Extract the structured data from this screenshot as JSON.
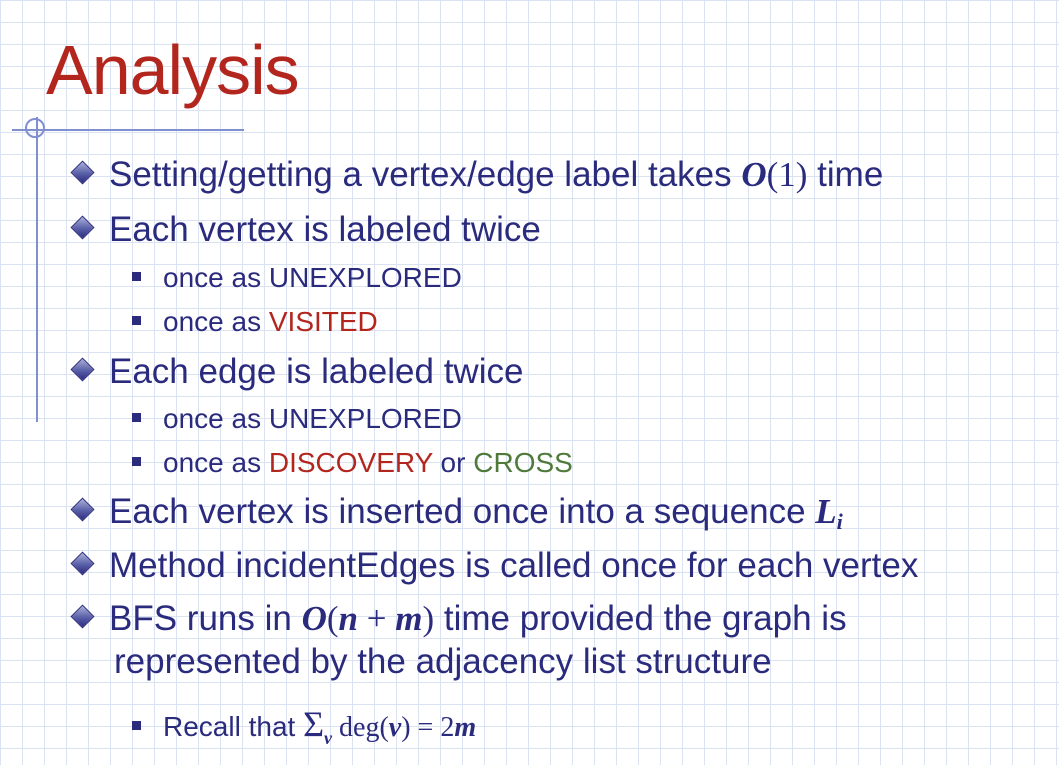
{
  "title": "Analysis",
  "bullets": {
    "b1": {
      "text": "Setting/getting a vertex/edge label takes ",
      "math_o": "O",
      "math_arg": "(1)",
      "text_after": " time"
    },
    "b2": {
      "text": "Each vertex is labeled twice"
    },
    "b2_s1": {
      "text": "once as UNEXPLORED"
    },
    "b2_s2": {
      "prefix": "once as ",
      "highlight": "VISITED"
    },
    "b3": {
      "text": "Each edge is labeled twice"
    },
    "b3_s1": {
      "text": "once as UNEXPLORED"
    },
    "b3_s2": {
      "prefix": "once as ",
      "highlight1": "DISCOVERY",
      "middle": " or ",
      "highlight2": "CROSS"
    },
    "b4": {
      "text": "Each vertex is inserted once into a sequence ",
      "math_var": "L",
      "math_sub": "i"
    },
    "b5": {
      "text": "Method incidentEdges is called once for each vertex"
    },
    "b6": {
      "text1": "BFS runs in ",
      "math_o": "O",
      "math_open": "(",
      "math_n": "n",
      "math_plus": " + ",
      "math_m": "m",
      "math_close": ")",
      "text2": " time provided the graph is",
      "line2": "represented by the adjacency list structure"
    },
    "b6_s1": {
      "prefix": "Recall that ",
      "sigma": "Σ",
      "sigma_sub": "v",
      "deg": " deg(",
      "var_v": "v",
      "eq": ") = 2",
      "var_m": "m"
    }
  },
  "colors": {
    "title": "#b3261e",
    "text": "#2b2b7e",
    "red": "#b3261e",
    "green": "#4f7a3a",
    "grid": "#dbe3f3"
  }
}
